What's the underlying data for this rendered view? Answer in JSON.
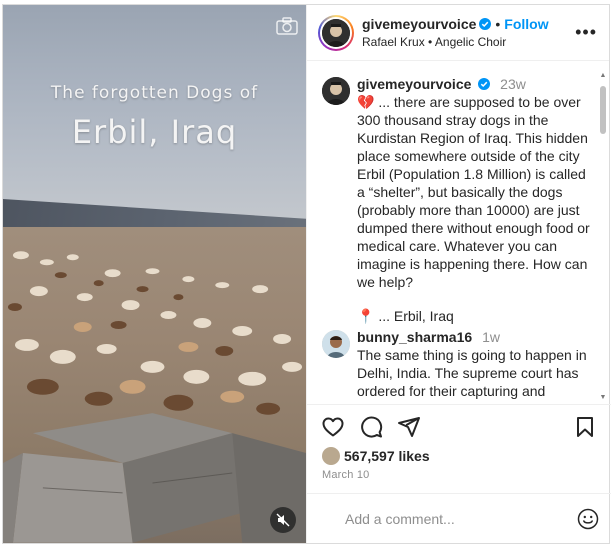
{
  "media": {
    "overlay_line1": "The forgotten Dogs of",
    "overlay_line2": "Erbil, Iraq"
  },
  "header": {
    "username": "givemeyourvoice",
    "dot": "•",
    "follow_label": "Follow",
    "subtitle": "Rafael Krux • Angelic Choir",
    "more_label": "•••"
  },
  "caption": {
    "username": "givemeyourvoice",
    "time": "23w",
    "text": "💔 ... there are supposed to be over 300 thousand stray dogs in the Kurdistan Region of Iraq. This hidden place somewhere outside of the city Erbil (Population 1.8 Million) is called a “shelter”, but basically the dogs (probably more than 10000) are just dumped there without enough food or medical care. Whatever you can imagine is happening there. How can we help?",
    "location": "📍 ... Erbil, Iraq"
  },
  "comment2": {
    "username": "bunny_sharma16",
    "time": "1w",
    "text": "The same thing is going to happen in Delhi, India. The supreme court has ordered for their capturing and relocating them into the shelters"
  },
  "actions": {
    "likes": "567,597 likes",
    "date": "March 10"
  },
  "add_comment": {
    "placeholder": "Add a comment..."
  },
  "colors": {
    "accent": "#0095f6",
    "text": "#262626",
    "muted": "#8e8e8e"
  }
}
